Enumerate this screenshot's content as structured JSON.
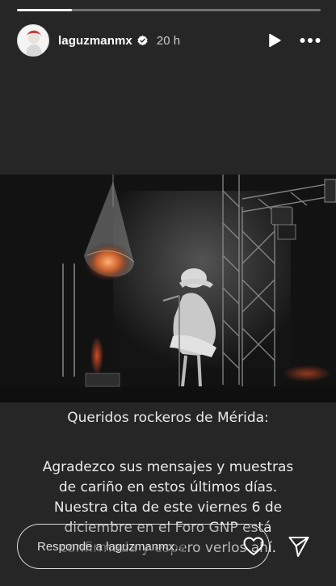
{
  "story": {
    "progress_fraction": 0.18
  },
  "header": {
    "username": "laguzmanmx",
    "verified": true,
    "timestamp": "20 h",
    "icons": [
      "avatar",
      "verified-badge-icon",
      "play-icon",
      "more-options-icon"
    ]
  },
  "photo": {
    "description_icon": "concert-photo"
  },
  "message": {
    "title": "Queridos rockeros de Mérida:",
    "lines": [
      "Agradezco sus mensajes y muestras",
      "de cariño en estos últimos días.",
      "Nuestra cita de este viernes 6 de",
      "diciembre en el Foro GNP está",
      "confirmada y espero verlos ahí."
    ]
  },
  "reply": {
    "placeholder": "Responde a laguzmanmx..."
  },
  "colors": {
    "background": "#262626",
    "text": "#ffffff"
  }
}
